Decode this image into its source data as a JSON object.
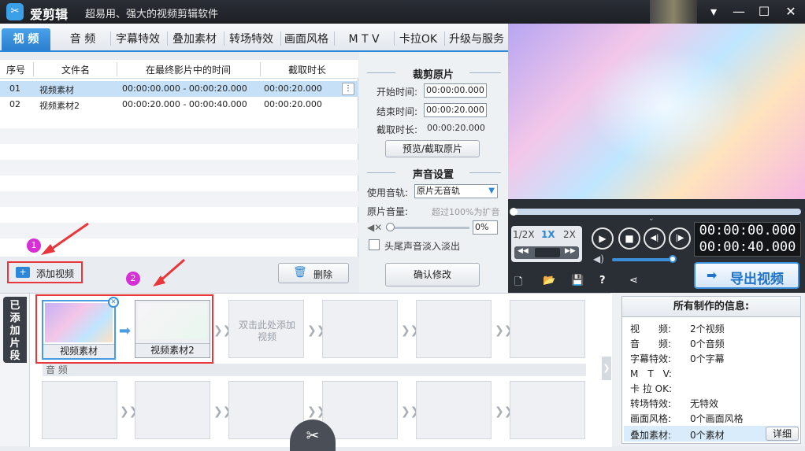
{
  "app": {
    "name": "爱剪辑",
    "slogan": "超易用、强大的视频剪辑软件",
    "logo_icon": "✂"
  },
  "window_controls": [
    "▾",
    "—",
    "☐",
    "✕"
  ],
  "tabs": [
    "视 频",
    "音 频",
    "字幕特效",
    "叠加素材",
    "转场特效",
    "画面风格",
    "M T V",
    "卡拉OK",
    "升级与服务"
  ],
  "active_tab": "视 频",
  "table": {
    "headers": [
      "序号",
      "文件名",
      "在最终影片中的时间",
      "截取时长"
    ],
    "rows": [
      {
        "index": "01",
        "name": "视频素材",
        "span": "00:00:00.000 - 00:00:20.000",
        "duration": "00:00:20.000"
      },
      {
        "index": "02",
        "name": "视频素材2",
        "span": "00:00:20.000 - 00:00:40.000",
        "duration": "00:00:20.000"
      }
    ],
    "more_button": "⋮"
  },
  "buttons": {
    "add_video": "添加视频",
    "delete": "删除",
    "preview_crop": "预览/截取原片",
    "confirm": "确认修改",
    "export": "导出视频",
    "details": "详细"
  },
  "crop": {
    "title": "裁剪原片",
    "start_label": "开始时间:",
    "start_value": "00:00:00.000",
    "end_label": "结束时间:",
    "end_value": "00:00:20.000",
    "length_label": "截取时长:",
    "length_value": "00:00:20.000"
  },
  "sound": {
    "title": "声音设置",
    "track_label": "使用音轨:",
    "track_value": "原片无音轨",
    "volume_label": "原片音量:",
    "volume_hint": "超过100%为扩音",
    "volume_value": "0%",
    "fade_label": "头尾声音淡入淡出"
  },
  "player": {
    "speeds": [
      "1/2X",
      "1X",
      "2X"
    ],
    "active_speed": "1X",
    "time_current": "00:00:00.000",
    "time_total": "00:00:40.000"
  },
  "storyboard": {
    "side_label": "已添加片段",
    "clips": [
      "视频素材",
      "视频素材2"
    ],
    "placeholder": "双击此处添加视频",
    "audio_label": "音 频"
  },
  "info": {
    "title": "所有制作的信息:",
    "rows": [
      {
        "label": "视　　频:",
        "value": "2个视频"
      },
      {
        "label": "音　　频:",
        "value": "0个音频"
      },
      {
        "label": "字幕特效:",
        "value": "0个字幕"
      },
      {
        "label": "M　T　V:",
        "value": ""
      },
      {
        "label": "卡 拉 OK:",
        "value": ""
      },
      {
        "label": "转场特效:",
        "value": "无特效"
      },
      {
        "label": "画面风格:",
        "value": "0个画面风格"
      },
      {
        "label": "叠加素材:",
        "value": "0个素材"
      }
    ]
  },
  "annotations": [
    "1",
    "2"
  ],
  "colors": {
    "accent": "#2d86d6",
    "annotation": "#e8363a",
    "badge": "#d62fd6"
  }
}
